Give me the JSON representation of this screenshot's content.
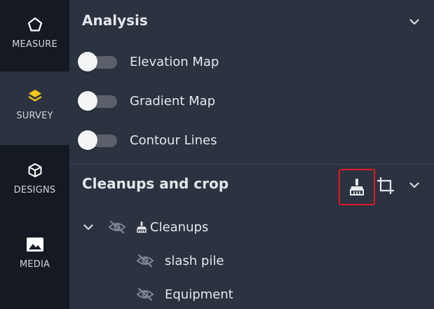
{
  "rail": {
    "items": [
      {
        "label": "MEASURE",
        "icon": "pentagon-icon"
      },
      {
        "label": "SURVEY",
        "icon": "layers-icon",
        "active": true
      },
      {
        "label": "DESIGNS",
        "icon": "cube-icon"
      },
      {
        "label": "MEDIA",
        "icon": "image-icon"
      }
    ]
  },
  "analysis": {
    "title": "Analysis",
    "toggles": [
      {
        "label": "Elevation Map",
        "on": false
      },
      {
        "label": "Gradient Map",
        "on": false
      },
      {
        "label": "Contour Lines",
        "on": false
      }
    ]
  },
  "cleanups": {
    "title": "Cleanups and crop",
    "group_label": "Cleanups",
    "items": [
      {
        "label": "slash pile",
        "visible": false
      },
      {
        "label": "Equipment",
        "visible": false
      }
    ]
  },
  "colors": {
    "accent_yellow": "#f5c518",
    "highlight_red": "#e01b24",
    "panel_bg": "#2b3240",
    "rail_bg": "#151a22"
  }
}
